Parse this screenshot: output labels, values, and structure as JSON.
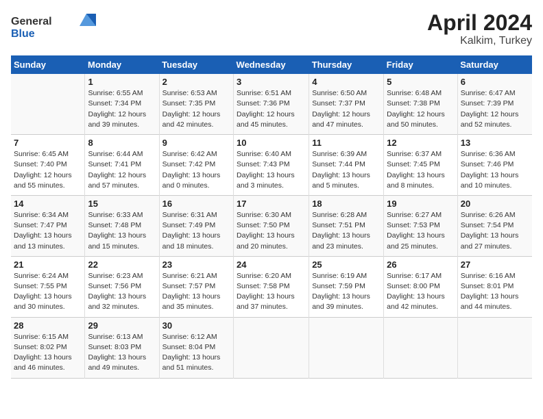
{
  "logo": {
    "general": "General",
    "blue": "Blue"
  },
  "title": "April 2024",
  "subtitle": "Kalkim, Turkey",
  "days_header": [
    "Sunday",
    "Monday",
    "Tuesday",
    "Wednesday",
    "Thursday",
    "Friday",
    "Saturday"
  ],
  "weeks": [
    [
      {
        "day": "",
        "info": ""
      },
      {
        "day": "1",
        "info": "Sunrise: 6:55 AM\nSunset: 7:34 PM\nDaylight: 12 hours\nand 39 minutes."
      },
      {
        "day": "2",
        "info": "Sunrise: 6:53 AM\nSunset: 7:35 PM\nDaylight: 12 hours\nand 42 minutes."
      },
      {
        "day": "3",
        "info": "Sunrise: 6:51 AM\nSunset: 7:36 PM\nDaylight: 12 hours\nand 45 minutes."
      },
      {
        "day": "4",
        "info": "Sunrise: 6:50 AM\nSunset: 7:37 PM\nDaylight: 12 hours\nand 47 minutes."
      },
      {
        "day": "5",
        "info": "Sunrise: 6:48 AM\nSunset: 7:38 PM\nDaylight: 12 hours\nand 50 minutes."
      },
      {
        "day": "6",
        "info": "Sunrise: 6:47 AM\nSunset: 7:39 PM\nDaylight: 12 hours\nand 52 minutes."
      }
    ],
    [
      {
        "day": "7",
        "info": "Sunrise: 6:45 AM\nSunset: 7:40 PM\nDaylight: 12 hours\nand 55 minutes."
      },
      {
        "day": "8",
        "info": "Sunrise: 6:44 AM\nSunset: 7:41 PM\nDaylight: 12 hours\nand 57 minutes."
      },
      {
        "day": "9",
        "info": "Sunrise: 6:42 AM\nSunset: 7:42 PM\nDaylight: 13 hours\nand 0 minutes."
      },
      {
        "day": "10",
        "info": "Sunrise: 6:40 AM\nSunset: 7:43 PM\nDaylight: 13 hours\nand 3 minutes."
      },
      {
        "day": "11",
        "info": "Sunrise: 6:39 AM\nSunset: 7:44 PM\nDaylight: 13 hours\nand 5 minutes."
      },
      {
        "day": "12",
        "info": "Sunrise: 6:37 AM\nSunset: 7:45 PM\nDaylight: 13 hours\nand 8 minutes."
      },
      {
        "day": "13",
        "info": "Sunrise: 6:36 AM\nSunset: 7:46 PM\nDaylight: 13 hours\nand 10 minutes."
      }
    ],
    [
      {
        "day": "14",
        "info": "Sunrise: 6:34 AM\nSunset: 7:47 PM\nDaylight: 13 hours\nand 13 minutes."
      },
      {
        "day": "15",
        "info": "Sunrise: 6:33 AM\nSunset: 7:48 PM\nDaylight: 13 hours\nand 15 minutes."
      },
      {
        "day": "16",
        "info": "Sunrise: 6:31 AM\nSunset: 7:49 PM\nDaylight: 13 hours\nand 18 minutes."
      },
      {
        "day": "17",
        "info": "Sunrise: 6:30 AM\nSunset: 7:50 PM\nDaylight: 13 hours\nand 20 minutes."
      },
      {
        "day": "18",
        "info": "Sunrise: 6:28 AM\nSunset: 7:51 PM\nDaylight: 13 hours\nand 23 minutes."
      },
      {
        "day": "19",
        "info": "Sunrise: 6:27 AM\nSunset: 7:53 PM\nDaylight: 13 hours\nand 25 minutes."
      },
      {
        "day": "20",
        "info": "Sunrise: 6:26 AM\nSunset: 7:54 PM\nDaylight: 13 hours\nand 27 minutes."
      }
    ],
    [
      {
        "day": "21",
        "info": "Sunrise: 6:24 AM\nSunset: 7:55 PM\nDaylight: 13 hours\nand 30 minutes."
      },
      {
        "day": "22",
        "info": "Sunrise: 6:23 AM\nSunset: 7:56 PM\nDaylight: 13 hours\nand 32 minutes."
      },
      {
        "day": "23",
        "info": "Sunrise: 6:21 AM\nSunset: 7:57 PM\nDaylight: 13 hours\nand 35 minutes."
      },
      {
        "day": "24",
        "info": "Sunrise: 6:20 AM\nSunset: 7:58 PM\nDaylight: 13 hours\nand 37 minutes."
      },
      {
        "day": "25",
        "info": "Sunrise: 6:19 AM\nSunset: 7:59 PM\nDaylight: 13 hours\nand 39 minutes."
      },
      {
        "day": "26",
        "info": "Sunrise: 6:17 AM\nSunset: 8:00 PM\nDaylight: 13 hours\nand 42 minutes."
      },
      {
        "day": "27",
        "info": "Sunrise: 6:16 AM\nSunset: 8:01 PM\nDaylight: 13 hours\nand 44 minutes."
      }
    ],
    [
      {
        "day": "28",
        "info": "Sunrise: 6:15 AM\nSunset: 8:02 PM\nDaylight: 13 hours\nand 46 minutes."
      },
      {
        "day": "29",
        "info": "Sunrise: 6:13 AM\nSunset: 8:03 PM\nDaylight: 13 hours\nand 49 minutes."
      },
      {
        "day": "30",
        "info": "Sunrise: 6:12 AM\nSunset: 8:04 PM\nDaylight: 13 hours\nand 51 minutes."
      },
      {
        "day": "",
        "info": ""
      },
      {
        "day": "",
        "info": ""
      },
      {
        "day": "",
        "info": ""
      },
      {
        "day": "",
        "info": ""
      }
    ]
  ]
}
